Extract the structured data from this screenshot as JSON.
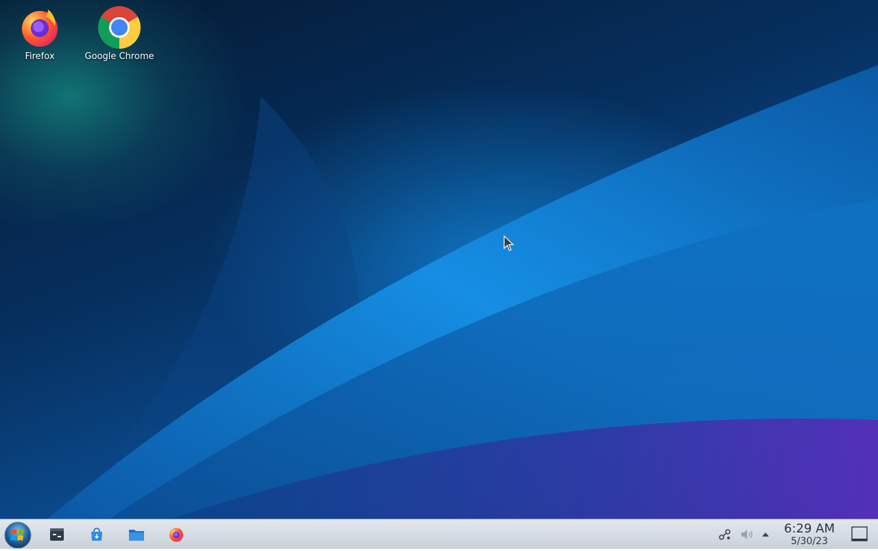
{
  "desktop": {
    "icons": [
      {
        "label": "Firefox",
        "icon": "firefox-icon"
      },
      {
        "label": "Google Chrome",
        "icon": "chrome-icon"
      }
    ]
  },
  "taskbar": {
    "start": {
      "icon": "windows-logo-icon"
    },
    "pinned": [
      {
        "name": "system-settings",
        "icon": "terminal-window-icon"
      },
      {
        "name": "software-store",
        "icon": "store-bag-icon"
      },
      {
        "name": "file-manager",
        "icon": "folder-icon"
      },
      {
        "name": "firefox",
        "icon": "firefox-icon"
      }
    ],
    "tray": {
      "icons": [
        "network-icon",
        "volume-icon",
        "expand-arrow-icon"
      ]
    },
    "clock": {
      "time": "6:29 AM",
      "date": "5/30/23"
    },
    "show_desktop": {
      "icon": "show-desktop-icon"
    }
  },
  "colors": {
    "taskbar_bg": "#d5dbe2",
    "accent_blue": "#1a8ee8",
    "accent_purple": "#8a1cc0"
  }
}
